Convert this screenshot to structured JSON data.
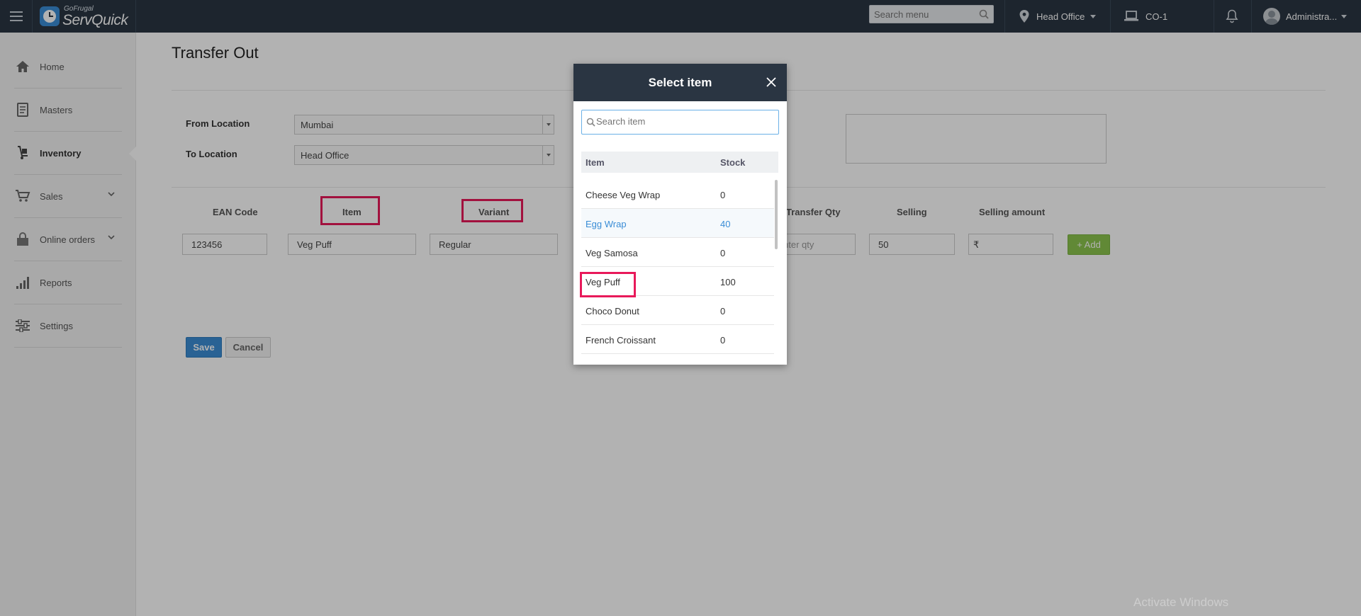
{
  "app": {
    "brand_sub": "GoFrugal",
    "brand_main": "ServQuick"
  },
  "topbar": {
    "search_placeholder": "Search menu",
    "location": "Head Office",
    "counter": "CO-1",
    "user": "Administra..."
  },
  "sidebar": {
    "items": [
      {
        "label": "Home",
        "icon": "home-icon"
      },
      {
        "label": "Masters",
        "icon": "book-icon"
      },
      {
        "label": "Inventory",
        "icon": "hand-truck-icon",
        "active": true
      },
      {
        "label": "Sales",
        "icon": "cart-icon"
      },
      {
        "label": "Online orders",
        "icon": "bag-icon"
      },
      {
        "label": "Reports",
        "icon": "bar-chart-icon"
      },
      {
        "label": "Settings",
        "icon": "sliders-icon"
      }
    ]
  },
  "page": {
    "title": "Transfer Out",
    "from_location_label": "From Location",
    "from_location_value": "Mumbai",
    "to_location_label": "To Location",
    "to_location_value": "Head Office",
    "columns": {
      "ean": "EAN Code",
      "item": "Item",
      "variant": "Variant",
      "transfer_qty": "Transfer Qty",
      "selling": "Selling",
      "selling_amount": "Selling amount"
    },
    "entry": {
      "ean": "123456",
      "item": "Veg Puff",
      "variant": "Regular",
      "qty_placeholder": "nter qty",
      "selling": "50",
      "amount_prefix": "₹"
    },
    "add_label": "+ Add",
    "save_label": "Save",
    "cancel_label": "Cancel"
  },
  "modal": {
    "title": "Select item",
    "search_placeholder": "Search item",
    "col_item": "Item",
    "col_stock": "Stock",
    "rows": [
      {
        "item": "Cheese Veg Wrap",
        "stock": "0"
      },
      {
        "item": "Egg Wrap",
        "stock": "40"
      },
      {
        "item": "Veg Samosa",
        "stock": "0"
      },
      {
        "item": "Veg Puff",
        "stock": "100"
      },
      {
        "item": "Choco Donut",
        "stock": "0"
      },
      {
        "item": "French Croissant",
        "stock": "0"
      }
    ]
  },
  "watermark": "Activate Windows",
  "colors": {
    "topbar": "#2a3542",
    "accent": "#3a8dd6",
    "add": "#8cc44e",
    "highlight": "#e8195a"
  }
}
